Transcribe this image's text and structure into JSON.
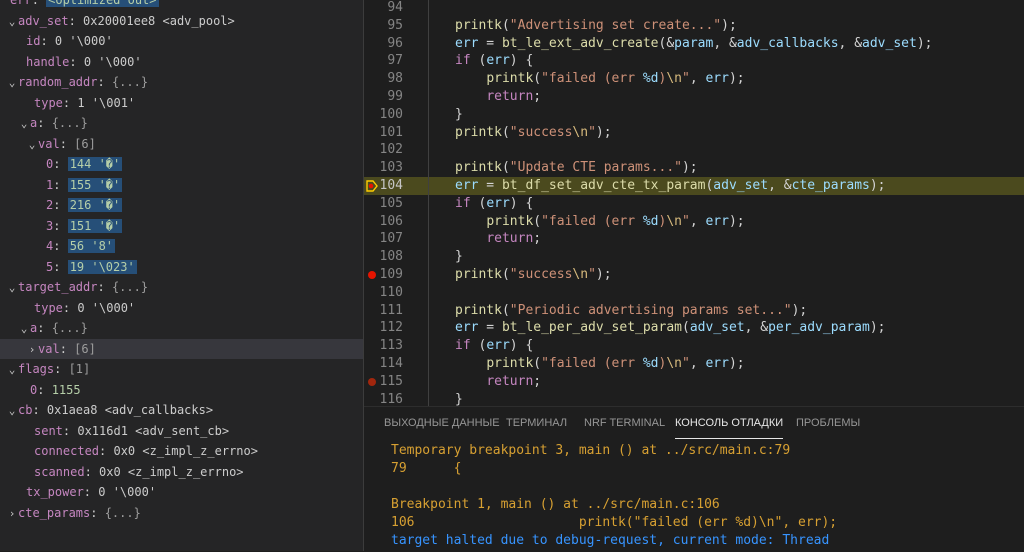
{
  "variables": [
    {
      "name": "err",
      "value": "<optimized out>",
      "style": "hl"
    },
    {
      "twisty": "v",
      "name": "adv_set",
      "value": "0x20001ee8 <adv_pool>",
      "style": ""
    },
    {
      "name": "id",
      "value": "0 '\\000'",
      "style": ""
    },
    {
      "name": "handle",
      "value": "0 '\\000'",
      "style": ""
    },
    {
      "twisty": "v",
      "name": "random_addr",
      "value": "{...}",
      "style": "dim"
    },
    {
      "name": "type",
      "value": "1 '\\001'",
      "style": ""
    },
    {
      "twisty": "v",
      "name": "a",
      "value": "{...}",
      "style": "dim"
    },
    {
      "twisty": "v",
      "name": "val",
      "value": "[6]",
      "style": "dim"
    },
    {
      "name": "0",
      "value": "144 '�'",
      "style": "hl"
    },
    {
      "name": "1",
      "value": "155 '�'",
      "style": "hl"
    },
    {
      "name": "2",
      "value": "216 '�'",
      "style": "hl"
    },
    {
      "name": "3",
      "value": "151 '�'",
      "style": "hl"
    },
    {
      "name": "4",
      "value": "56 '8'",
      "style": "hl"
    },
    {
      "name": "5",
      "value": "19 '\\023'",
      "style": "hl"
    },
    {
      "twisty": "v",
      "name": "target_addr",
      "value": "{...}",
      "style": "dim"
    },
    {
      "name": "type",
      "value": "0 '\\000'",
      "style": ""
    },
    {
      "twisty": "v",
      "name": "a",
      "value": "{...}",
      "style": "dim"
    },
    {
      "twisty": ">",
      "name": "val",
      "value": "[6]",
      "style": "dim"
    },
    {
      "twisty": "v",
      "name": "flags",
      "value": "[1]",
      "style": "dim"
    },
    {
      "name": "0",
      "value": "1155",
      "style": "num"
    },
    {
      "twisty": "v",
      "name": "cb",
      "value": "0x1aea8 <adv_callbacks>",
      "style": ""
    },
    {
      "name": "sent",
      "value": "0x116d1 <adv_sent_cb>",
      "style": ""
    },
    {
      "name": "connected",
      "value": "0x0 <z_impl_z_errno>",
      "style": ""
    },
    {
      "name": "scanned",
      "value": "0x0 <z_impl_z_errno>",
      "style": ""
    },
    {
      "name": "tx_power",
      "value": "0 '\\000'",
      "style": ""
    },
    {
      "twisty": ">",
      "name": "cte_params",
      "value": "{...}",
      "style": "dim"
    }
  ],
  "code_lines": [
    {
      "num": "94",
      "marker": "",
      "tokens": []
    },
    {
      "num": "95",
      "marker": "",
      "tokens": [
        [
          "f",
          "printk"
        ],
        [
          "p",
          "("
        ],
        [
          "s",
          "\"Advertising set create...\""
        ],
        [
          "p",
          ");"
        ]
      ]
    },
    {
      "num": "96",
      "marker": "",
      "tokens": [
        [
          "v",
          "err"
        ],
        [
          "p",
          " = "
        ],
        [
          "f",
          "bt_le_ext_adv_create"
        ],
        [
          "p",
          "(&"
        ],
        [
          "v",
          "param"
        ],
        [
          "p",
          ", &"
        ],
        [
          "v",
          "adv_callbacks"
        ],
        [
          "p",
          ", &"
        ],
        [
          "v",
          "adv_set"
        ],
        [
          "p",
          ");"
        ]
      ]
    },
    {
      "num": "97",
      "marker": "",
      "tokens": [
        [
          "k",
          "if"
        ],
        [
          "p",
          " ("
        ],
        [
          "v",
          "err"
        ],
        [
          "p",
          ") {"
        ]
      ]
    },
    {
      "num": "98",
      "marker": "",
      "tokens": [
        [
          "p",
          "    "
        ],
        [
          "f",
          "printk"
        ],
        [
          "p",
          "("
        ],
        [
          "s",
          "\"failed (err "
        ],
        [
          "v",
          "%d"
        ],
        [
          "s",
          ")"
        ],
        [
          "e",
          "\\n"
        ],
        [
          "s",
          "\""
        ],
        [
          "p",
          ", "
        ],
        [
          "v",
          "err"
        ],
        [
          "p",
          ");"
        ]
      ]
    },
    {
      "num": "99",
      "marker": "",
      "tokens": [
        [
          "p",
          "    "
        ],
        [
          "k",
          "return"
        ],
        [
          "p",
          ";"
        ]
      ]
    },
    {
      "num": "100",
      "marker": "",
      "tokens": [
        [
          "p",
          "}"
        ]
      ]
    },
    {
      "num": "101",
      "marker": "",
      "tokens": [
        [
          "f",
          "printk"
        ],
        [
          "p",
          "("
        ],
        [
          "s",
          "\"success"
        ],
        [
          "e",
          "\\n"
        ],
        [
          "s",
          "\""
        ],
        [
          "p",
          ");"
        ]
      ]
    },
    {
      "num": "102",
      "marker": "",
      "tokens": []
    },
    {
      "num": "103",
      "marker": "",
      "tokens": [
        [
          "f",
          "printk"
        ],
        [
          "p",
          "("
        ],
        [
          "s",
          "\"Update CTE params...\""
        ],
        [
          "p",
          ");"
        ]
      ]
    },
    {
      "num": "104",
      "marker": "arrow",
      "tokens": [
        [
          "v",
          "err"
        ],
        [
          "p",
          " = "
        ],
        [
          "f",
          "bt_df_set_adv_cte_tx_param"
        ],
        [
          "p",
          "("
        ],
        [
          "v",
          "adv_set"
        ],
        [
          "p",
          ", &"
        ],
        [
          "v",
          "cte_params"
        ],
        [
          "p",
          ");"
        ]
      ]
    },
    {
      "num": "105",
      "marker": "",
      "tokens": [
        [
          "k",
          "if"
        ],
        [
          "p",
          " ("
        ],
        [
          "v",
          "err"
        ],
        [
          "p",
          ") {"
        ]
      ]
    },
    {
      "num": "106",
      "marker": "",
      "tokens": [
        [
          "p",
          "    "
        ],
        [
          "f",
          "printk"
        ],
        [
          "p",
          "("
        ],
        [
          "s",
          "\"failed (err "
        ],
        [
          "v",
          "%d"
        ],
        [
          "s",
          ")"
        ],
        [
          "e",
          "\\n"
        ],
        [
          "s",
          "\""
        ],
        [
          "p",
          ", "
        ],
        [
          "v",
          "err"
        ],
        [
          "p",
          ");"
        ]
      ]
    },
    {
      "num": "107",
      "marker": "",
      "tokens": [
        [
          "p",
          "    "
        ],
        [
          "k",
          "return"
        ],
        [
          "p",
          ";"
        ]
      ]
    },
    {
      "num": "108",
      "marker": "",
      "tokens": [
        [
          "p",
          "}"
        ]
      ]
    },
    {
      "num": "109",
      "marker": "bp",
      "tokens": [
        [
          "f",
          "printk"
        ],
        [
          "p",
          "("
        ],
        [
          "s",
          "\"success"
        ],
        [
          "e",
          "\\n"
        ],
        [
          "s",
          "\""
        ],
        [
          "p",
          ");"
        ]
      ]
    },
    {
      "num": "110",
      "marker": "",
      "tokens": []
    },
    {
      "num": "111",
      "marker": "",
      "tokens": [
        [
          "f",
          "printk"
        ],
        [
          "p",
          "("
        ],
        [
          "s",
          "\"Periodic advertising params set...\""
        ],
        [
          "p",
          ");"
        ]
      ]
    },
    {
      "num": "112",
      "marker": "",
      "tokens": [
        [
          "v",
          "err"
        ],
        [
          "p",
          " = "
        ],
        [
          "f",
          "bt_le_per_adv_set_param"
        ],
        [
          "p",
          "("
        ],
        [
          "v",
          "adv_set"
        ],
        [
          "p",
          ", &"
        ],
        [
          "v",
          "per_adv_param"
        ],
        [
          "p",
          ");"
        ]
      ]
    },
    {
      "num": "113",
      "marker": "",
      "tokens": [
        [
          "k",
          "if"
        ],
        [
          "p",
          " ("
        ],
        [
          "v",
          "err"
        ],
        [
          "p",
          ") {"
        ]
      ]
    },
    {
      "num": "114",
      "marker": "",
      "tokens": [
        [
          "p",
          "    "
        ],
        [
          "f",
          "printk"
        ],
        [
          "p",
          "("
        ],
        [
          "s",
          "\"failed (err "
        ],
        [
          "v",
          "%d"
        ],
        [
          "s",
          ")"
        ],
        [
          "e",
          "\\n"
        ],
        [
          "s",
          "\""
        ],
        [
          "p",
          ", "
        ],
        [
          "v",
          "err"
        ],
        [
          "p",
          ");"
        ]
      ]
    },
    {
      "num": "115",
      "marker": "bp-dim",
      "tokens": [
        [
          "p",
          "    "
        ],
        [
          "k",
          "return"
        ],
        [
          "p",
          ";"
        ]
      ]
    },
    {
      "num": "116",
      "marker": "",
      "tokens": [
        [
          "p",
          "}"
        ]
      ]
    }
  ],
  "panel_tabs": [
    {
      "label": "ВЫХОДНЫЕ ДАННЫЕ",
      "active": false
    },
    {
      "label": "ТЕРМИНАЛ",
      "active": false
    },
    {
      "label": "NRF TERMINAL",
      "active": false
    },
    {
      "label": "КОНСОЛЬ ОТЛАДКИ",
      "active": true
    },
    {
      "label": "ПРОБЛЕМЫ",
      "active": false
    }
  ],
  "console_lines": [
    {
      "text": "Temporary breakpoint 3, main () at ../src/main.c:79",
      "color": "y"
    },
    {
      "text": "79      {",
      "color": "y"
    },
    {
      "text": "",
      "color": "y"
    },
    {
      "text": "Breakpoint 1, main () at ../src/main.c:106",
      "color": "y"
    },
    {
      "text": "106                     printk(\"failed (err %d)\\n\", err);",
      "color": "y"
    },
    {
      "text": "target halted due to debug-request, current mode: Thread",
      "color": "b"
    }
  ],
  "colors": {
    "accent": "#3794ff",
    "current_line": "#4b4a1e",
    "breakpoint": "#e51400"
  }
}
